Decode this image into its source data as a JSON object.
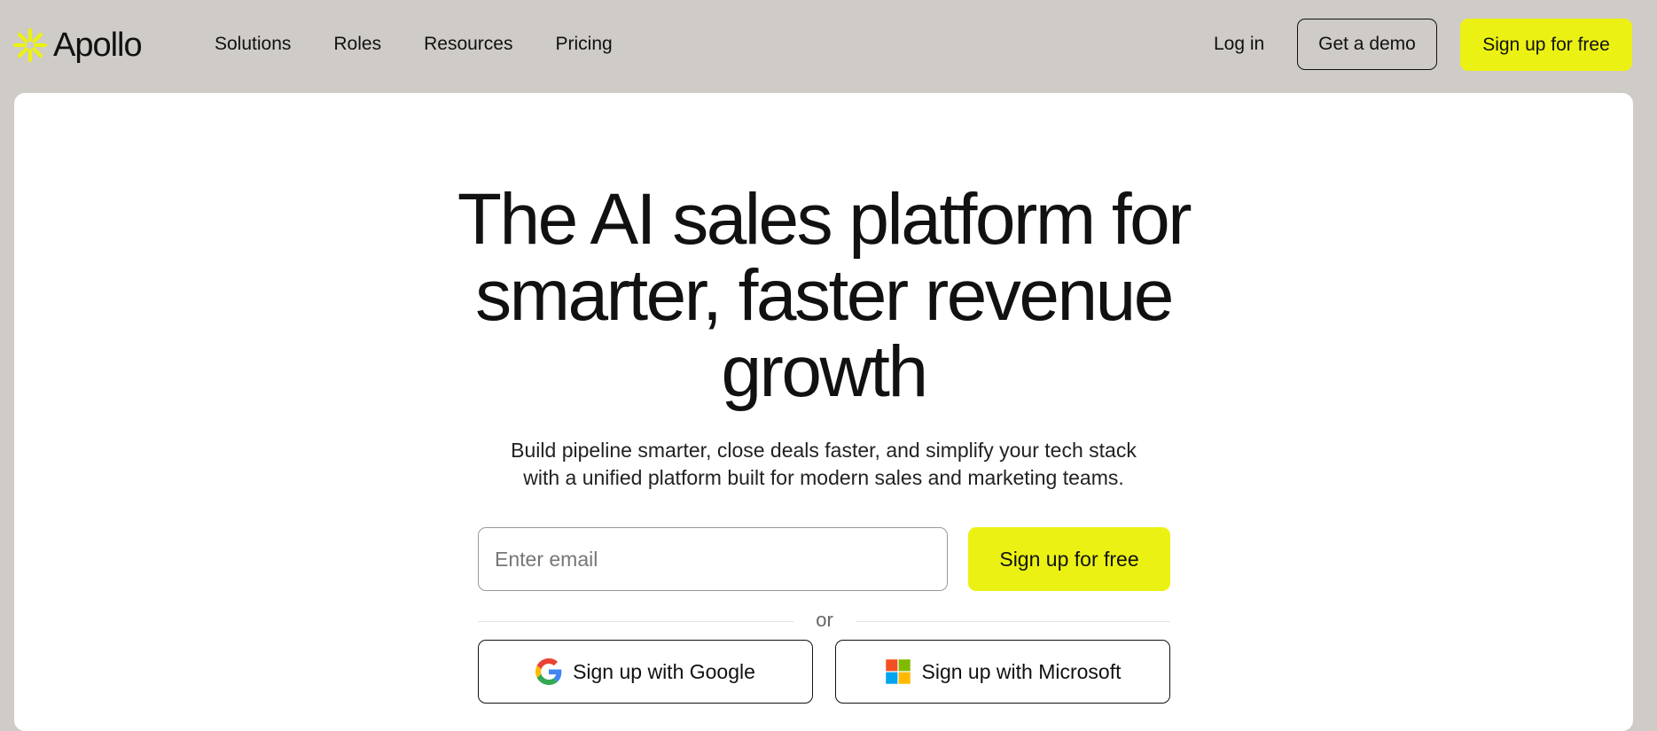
{
  "brand": {
    "name": "Apollo",
    "accent_color": "#ebf213",
    "logo_icon": "asterisk-logo-icon"
  },
  "nav": {
    "items": [
      {
        "label": "Solutions"
      },
      {
        "label": "Roles"
      },
      {
        "label": "Resources"
      },
      {
        "label": "Pricing"
      }
    ]
  },
  "header_actions": {
    "login_label": "Log in",
    "demo_label": "Get a demo",
    "signup_label": "Sign up for free"
  },
  "hero": {
    "headline_lines": [
      "The AI sales platform for",
      "smarter, faster revenue",
      "growth"
    ],
    "subtext_lines": [
      "Build pipeline smarter, close deals faster, and simplify your tech stack",
      "with a unified platform built for modern sales and marketing teams."
    ],
    "email_placeholder": "Enter email",
    "signup_label": "Sign up for free",
    "divider_text": "or",
    "google_label": "Sign up with Google",
    "microsoft_label": "Sign up with Microsoft"
  }
}
